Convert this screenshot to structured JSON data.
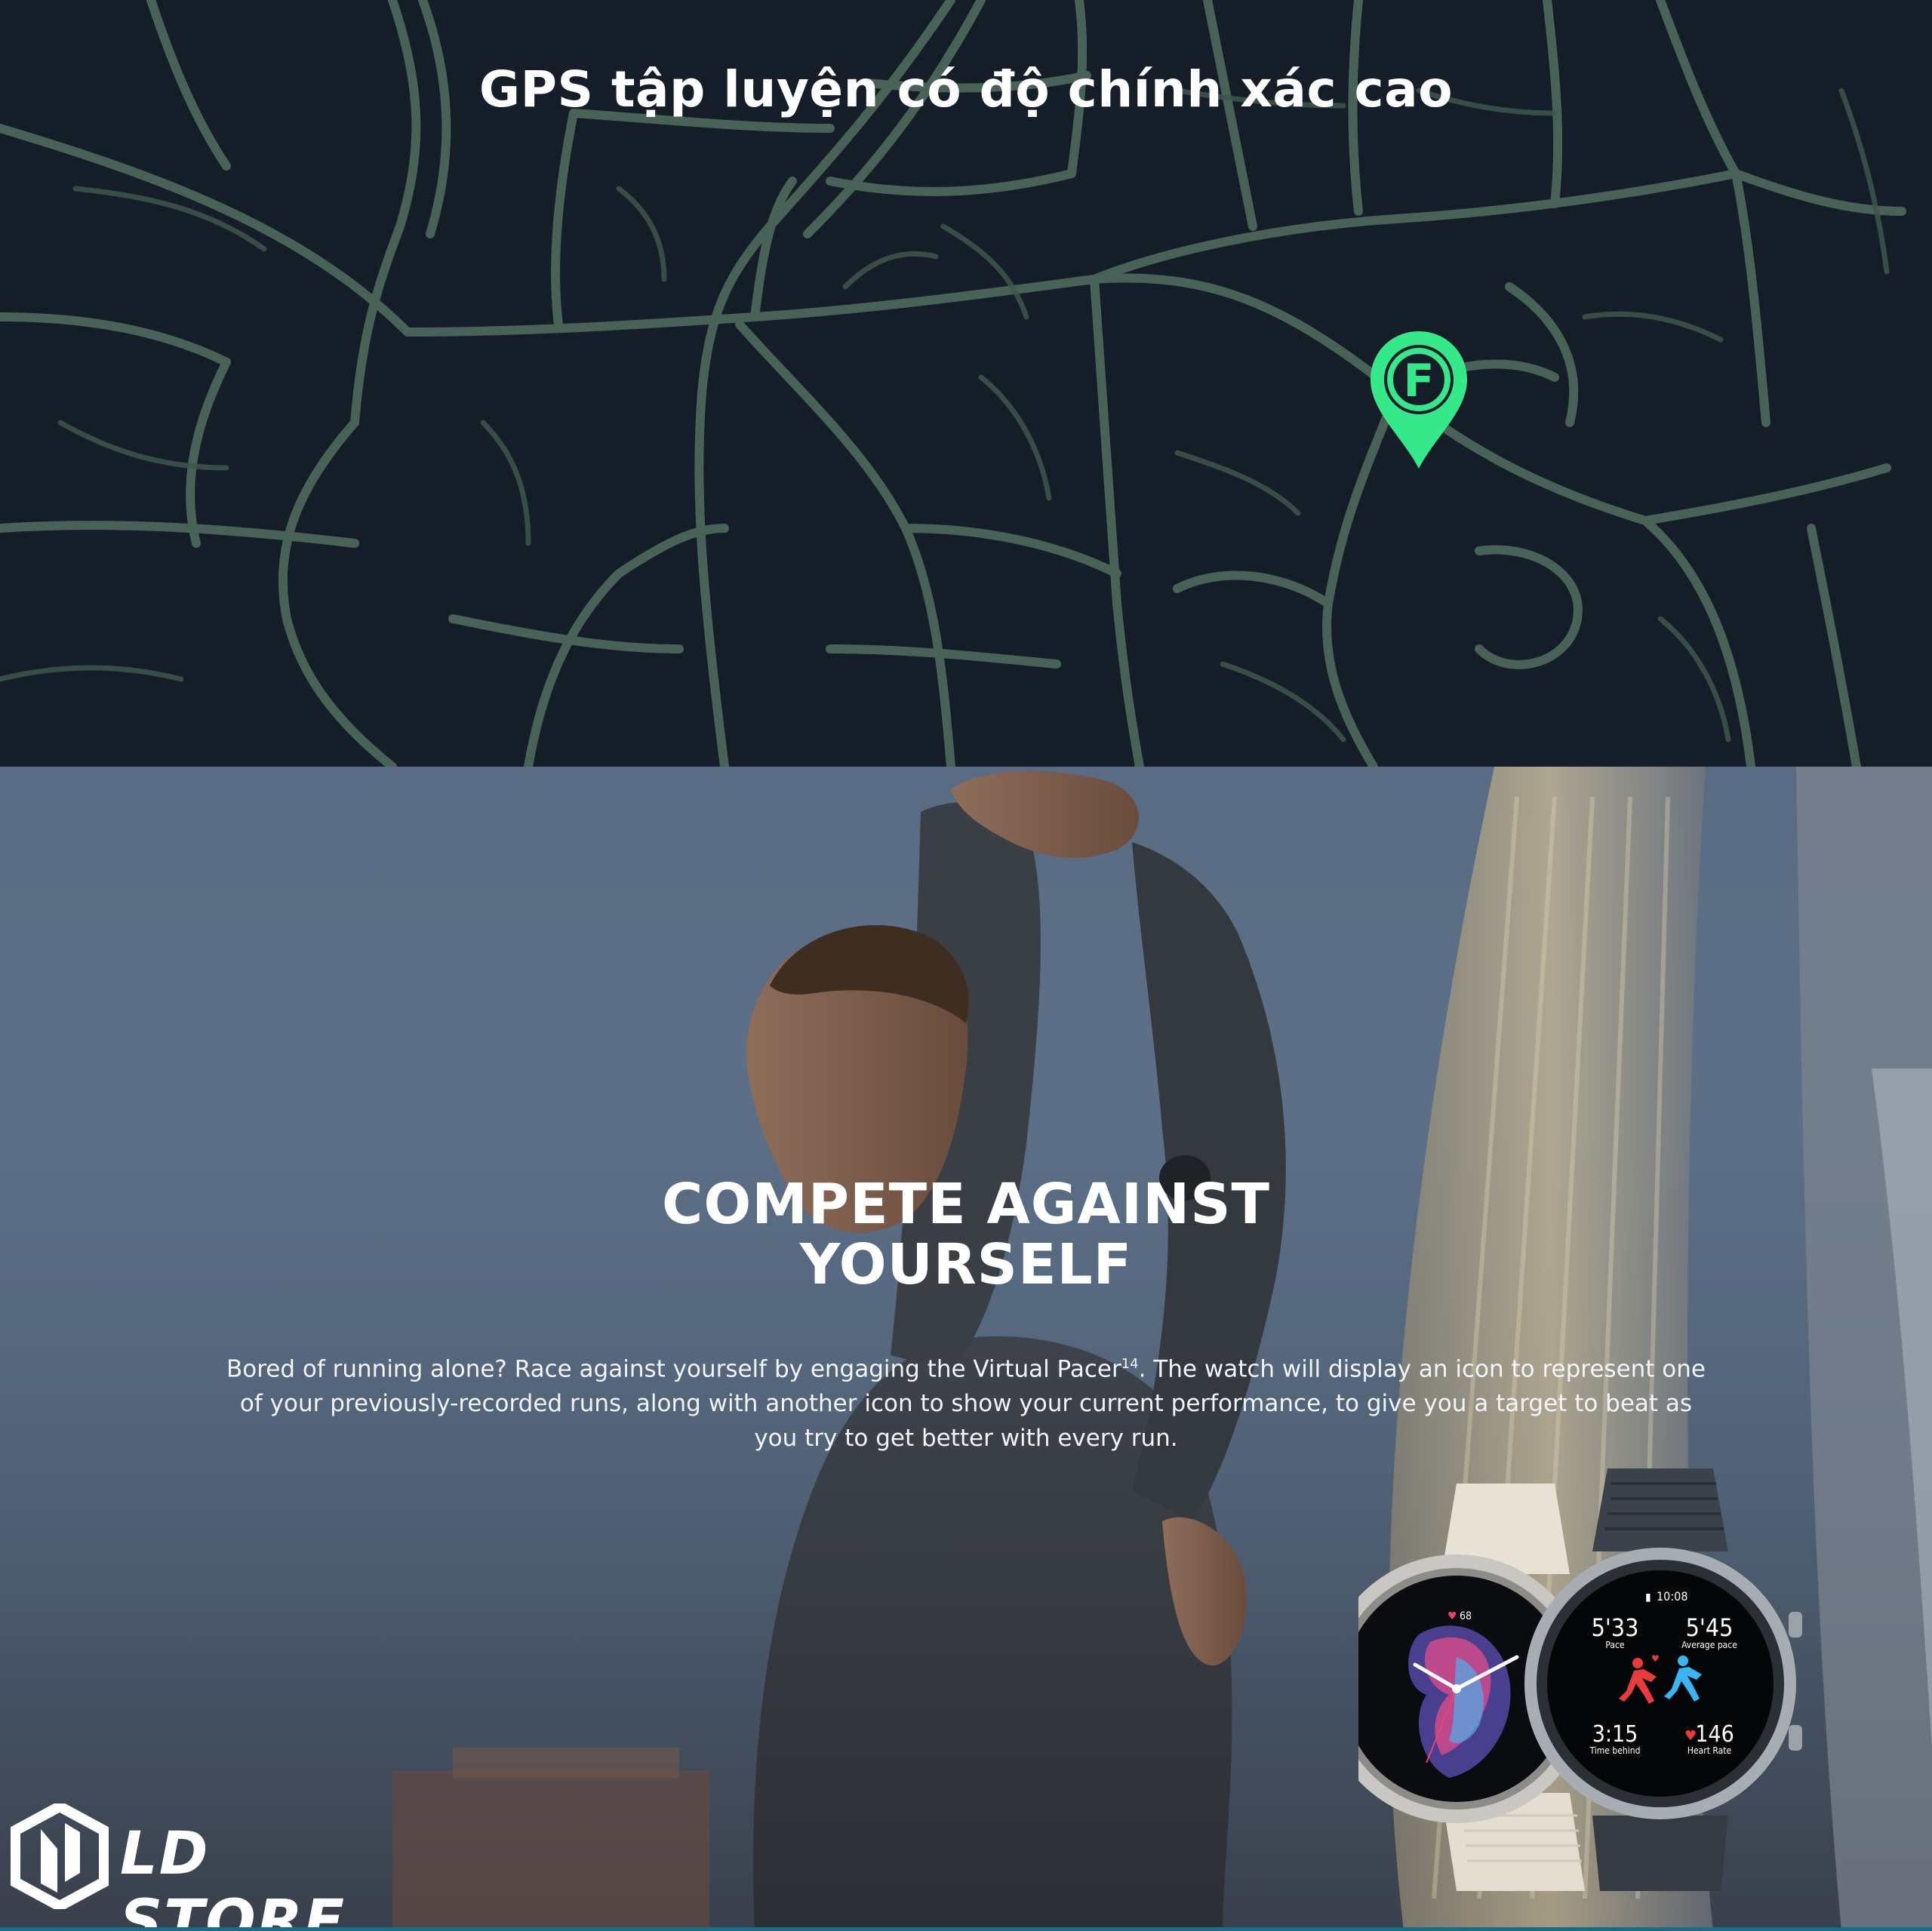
{
  "map": {
    "title": "GPS tập luyện có độ chính xác cao",
    "pin_letter": "F",
    "pin_icon": "location-pin-icon",
    "road_color": "#4e6a5c",
    "pin_color": "#35e889"
  },
  "hero": {
    "title_line1": "COMPETE AGAINST",
    "title_line2": "YOURSELF",
    "body_before_sup": "Bored of running alone? Race against yourself by engaging the Virtual Pacer",
    "body_sup": "14",
    "body_after_sup": ". The watch will display an icon to represent one of your previously-recorded runs, along with another icon to show your current performance, to give you a target to beat as you try to get better with every run."
  },
  "watch_left": {
    "heart_value": "68"
  },
  "watch_right": {
    "time": "10:08",
    "pace_value": "5'33",
    "pace_label": "Pace",
    "avg_pace_value": "5'45",
    "avg_pace_label": "Average pace",
    "time_behind_value": "3:15",
    "time_behind_label": "Time behind",
    "heart_rate_value": "146",
    "heart_rate_label": "Heart Rate"
  },
  "logo": {
    "text": "LD STORE",
    "icon": "ld-hexagon-logo-icon"
  }
}
